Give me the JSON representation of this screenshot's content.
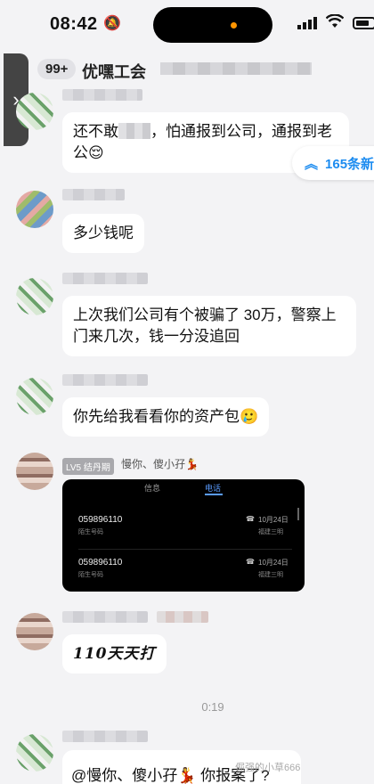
{
  "status_bar": {
    "time": "08:42",
    "mute_icon": "bell-slash-icon",
    "signal_icon": "cellular-signal-icon",
    "wifi_icon": "wifi-icon",
    "battery_icon": "battery-icon"
  },
  "header": {
    "unread_count": "99+",
    "group_title": "优嘿工会",
    "back_icon": "chevron-left-icon"
  },
  "side_tab": {
    "icon": "chevron-right-icon"
  },
  "jump_pill": {
    "label": "165条新",
    "icon": "double-chevron-up-icon"
  },
  "messages": [
    {
      "text_before": "还不敢",
      "text_after": "，怕通报到公司，通报到老公😌"
    },
    {
      "text": "多少钱呢"
    },
    {
      "text": "上次我们公司有个被骗了 30万，警察上门来几次，钱一分没追回"
    },
    {
      "text": "你先给我看看你的资产包🥲"
    },
    {
      "level_badge": "LV5 结丹期",
      "sender": "慢你、傻小孖💃",
      "screenshot": {
        "tab_left": "信息",
        "tab_right": "电话",
        "calls": [
          {
            "number": "059896110",
            "label": "陌生号码",
            "date": "10月24日",
            "location": "福建三明"
          },
          {
            "number": "059896110",
            "label": "陌生号码",
            "date": "10月24日",
            "location": "福建三明"
          }
        ]
      }
    },
    {
      "text": "110天天打"
    },
    {
      "voice_duration": "0:19"
    },
    {
      "text": "@慢你、傻小孖💃 你报案了?"
    }
  ],
  "watermark": "倔强的小草666",
  "colors": {
    "accent": "#1d8cf0",
    "background": "#f3f3f5",
    "bubble": "#ffffff"
  }
}
